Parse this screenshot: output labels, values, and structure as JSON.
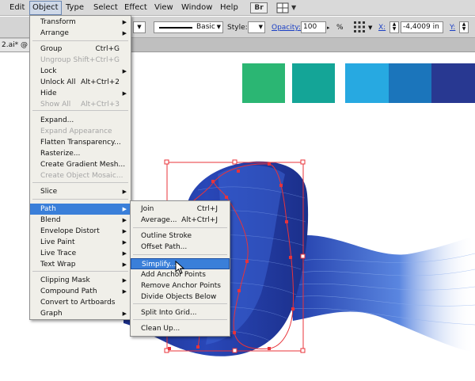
{
  "menubar": {
    "items": [
      "Edit",
      "Object",
      "Type",
      "Select",
      "Effect",
      "View",
      "Window",
      "Help"
    ],
    "active": "Object",
    "right_badge": "Br"
  },
  "controlbar": {
    "stroke_style": "Basic",
    "style_label": "Style:",
    "opacity_label": "Opacity:",
    "opacity_value": "100",
    "percent": "%",
    "x_label": "X:",
    "x_value": "-4,4009 in",
    "y_label": "Y:"
  },
  "document": {
    "tab_label": "2.ai* @"
  },
  "swatches": {
    "colors": [
      "#2bb673",
      "#14a597",
      "#27a9e1",
      "#1b75bb",
      "#283891"
    ]
  },
  "object_menu": {
    "items": [
      {
        "label": "Transform",
        "shortcut": "",
        "submenu": true,
        "disabled": false
      },
      {
        "label": "Arrange",
        "shortcut": "",
        "submenu": true,
        "disabled": false
      },
      {
        "label": "Group",
        "shortcut": "Ctrl+G",
        "submenu": false,
        "disabled": false
      },
      {
        "label": "Ungroup",
        "shortcut": "Shift+Ctrl+G",
        "submenu": false,
        "disabled": true
      },
      {
        "label": "Lock",
        "shortcut": "",
        "submenu": true,
        "disabled": false
      },
      {
        "label": "Unlock All",
        "shortcut": "Alt+Ctrl+2",
        "submenu": false,
        "disabled": false
      },
      {
        "label": "Hide",
        "shortcut": "",
        "submenu": true,
        "disabled": false
      },
      {
        "label": "Show All",
        "shortcut": "Alt+Ctrl+3",
        "submenu": false,
        "disabled": true
      },
      {
        "label": "Expand...",
        "shortcut": "",
        "submenu": false,
        "disabled": false
      },
      {
        "label": "Expand Appearance",
        "shortcut": "",
        "submenu": false,
        "disabled": true
      },
      {
        "label": "Flatten Transparency...",
        "shortcut": "",
        "submenu": false,
        "disabled": false
      },
      {
        "label": "Rasterize...",
        "shortcut": "",
        "submenu": false,
        "disabled": false
      },
      {
        "label": "Create Gradient Mesh...",
        "shortcut": "",
        "submenu": false,
        "disabled": false
      },
      {
        "label": "Create Object Mosaic...",
        "shortcut": "",
        "submenu": false,
        "disabled": true
      },
      {
        "label": "Slice",
        "shortcut": "",
        "submenu": true,
        "disabled": false
      },
      {
        "label": "Path",
        "shortcut": "",
        "submenu": true,
        "disabled": false
      },
      {
        "label": "Blend",
        "shortcut": "",
        "submenu": true,
        "disabled": false
      },
      {
        "label": "Envelope Distort",
        "shortcut": "",
        "submenu": true,
        "disabled": false
      },
      {
        "label": "Live Paint",
        "shortcut": "",
        "submenu": true,
        "disabled": false
      },
      {
        "label": "Live Trace",
        "shortcut": "",
        "submenu": true,
        "disabled": false
      },
      {
        "label": "Text Wrap",
        "shortcut": "",
        "submenu": true,
        "disabled": false
      },
      {
        "label": "Clipping Mask",
        "shortcut": "",
        "submenu": true,
        "disabled": false
      },
      {
        "label": "Compound Path",
        "shortcut": "",
        "submenu": true,
        "disabled": false
      },
      {
        "label": "Convert to Artboards",
        "shortcut": "",
        "submenu": false,
        "disabled": false
      },
      {
        "label": "Graph",
        "shortcut": "",
        "submenu": true,
        "disabled": false
      }
    ],
    "highlighted": "Path"
  },
  "path_submenu": {
    "items": [
      {
        "label": "Join",
        "shortcut": "Ctrl+J"
      },
      {
        "label": "Average...",
        "shortcut": "Alt+Ctrl+J"
      },
      {
        "label": "Outline Stroke",
        "shortcut": ""
      },
      {
        "label": "Offset Path...",
        "shortcut": ""
      },
      {
        "label": "Simplify...",
        "shortcut": ""
      },
      {
        "label": "Add Anchor Points",
        "shortcut": ""
      },
      {
        "label": "Remove Anchor Points",
        "shortcut": ""
      },
      {
        "label": "Divide Objects Below",
        "shortcut": ""
      },
      {
        "label": "Split Into Grid...",
        "shortcut": ""
      },
      {
        "label": "Clean Up...",
        "shortcut": ""
      }
    ],
    "highlighted": "Simplify..."
  },
  "colors": {
    "menu_highlight": "#3a7fd9",
    "selection_red": "#e8333a",
    "artwork_dark": "#1b2f8a",
    "artwork_light": "#5a86e0"
  }
}
